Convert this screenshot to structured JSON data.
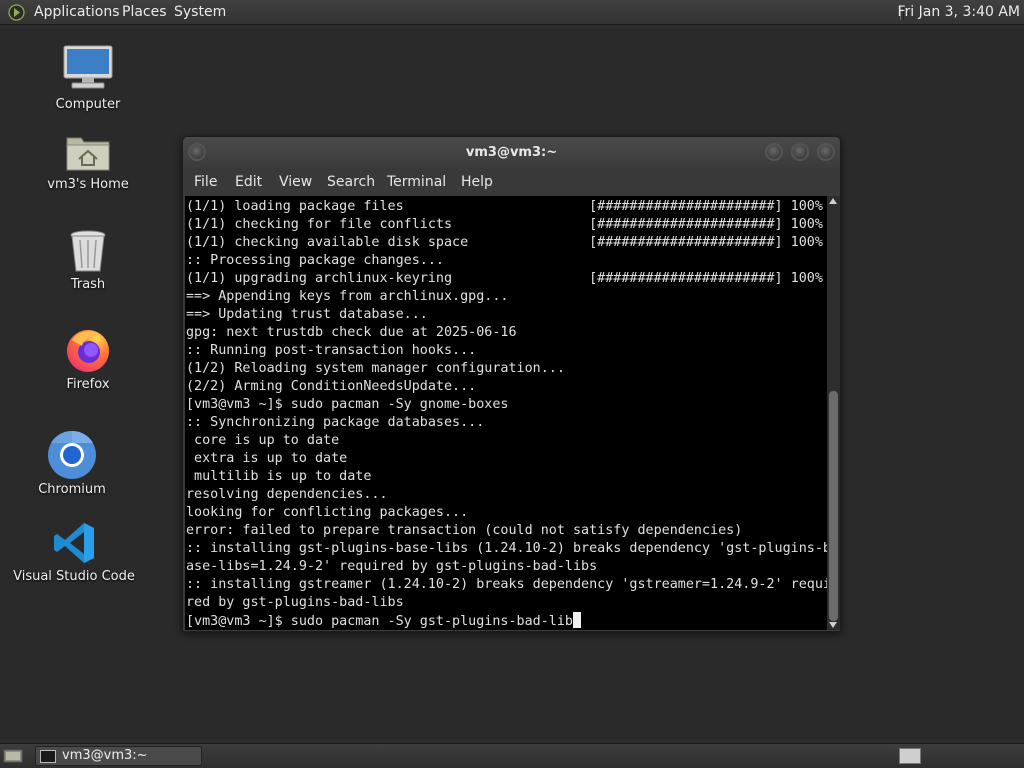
{
  "top_panel": {
    "menus": [
      "Applications",
      "Places",
      "System"
    ],
    "clock": "Fri Jan  3,  3:40 AM"
  },
  "desktop_icons": [
    {
      "label": "Computer",
      "icon": "computer-icon"
    },
    {
      "label": "vm3's Home",
      "icon": "home-folder-icon"
    },
    {
      "label": "Trash",
      "icon": "trash-icon"
    },
    {
      "label": "Firefox",
      "icon": "firefox-icon"
    },
    {
      "label": "Chromium",
      "icon": "chromium-icon"
    },
    {
      "label": "Visual Studio Code",
      "icon": "vscode-icon"
    }
  ],
  "terminal": {
    "title": "vm3@vm3:~",
    "menu": [
      "File",
      "Edit",
      "View",
      "Search",
      "Terminal",
      "Help"
    ],
    "lines": [
      "(1/1) loading package files                       [######################] 100%",
      "(1/1) checking for file conflicts                 [######################] 100%",
      "(1/1) checking available disk space               [######################] 100%",
      ":: Processing package changes...",
      "(1/1) upgrading archlinux-keyring                 [######################] 100%",
      "==> Appending keys from archlinux.gpg...",
      "==> Updating trust database...",
      "gpg: next trustdb check due at 2025-06-16",
      ":: Running post-transaction hooks...",
      "(1/2) Reloading system manager configuration...",
      "(2/2) Arming ConditionNeedsUpdate...",
      "[vm3@vm3 ~]$ sudo pacman -Sy gnome-boxes",
      ":: Synchronizing package databases...",
      " core is up to date",
      " extra is up to date",
      " multilib is up to date",
      "resolving dependencies...",
      "looking for conflicting packages...",
      "error: failed to prepare transaction (could not satisfy dependencies)",
      ":: installing gst-plugins-base-libs (1.24.10-2) breaks dependency 'gst-plugins-b",
      "ase-libs=1.24.9-2' required by gst-plugins-bad-libs",
      ":: installing gstreamer (1.24.10-2) breaks dependency 'gstreamer=1.24.9-2' requi",
      "red by gst-plugins-bad-libs"
    ],
    "prompt_line": "[vm3@vm3 ~]$ sudo pacman -Sy gst-plugins-bad-lib"
  },
  "taskbar": {
    "task_label": "vm3@vm3:~"
  },
  "colors": {
    "desktop_bg": "#2a2a2a",
    "terminal_bg": "#000000",
    "terminal_fg": "#e0e0e0"
  }
}
